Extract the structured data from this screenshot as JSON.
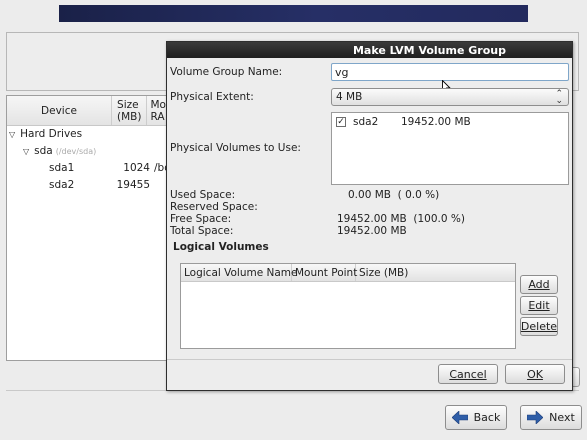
{
  "device_table": {
    "headers": {
      "device": "Device",
      "size_line1": "Size",
      "size_line2": "(MB)",
      "mount_line1": "Mo",
      "mount_line2": "RA"
    },
    "hard_drives_label": "Hard Drives",
    "disk": {
      "name": "sda",
      "path": "(/dev/sda)"
    },
    "partitions": [
      {
        "name": "sda1",
        "size": "1024",
        "mount": "/bo"
      },
      {
        "name": "sda2",
        "size": "19455",
        "mount": ""
      }
    ]
  },
  "dialog": {
    "title": "Make LVM Volume Group",
    "volume_group_name_label": "Volume Group Name:",
    "volume_group_name_value": "vg",
    "physical_extent_label": "Physical Extent:",
    "physical_extent_value": "4 MB",
    "physical_volumes_label": "Physical Volumes to Use:",
    "physical_volumes": [
      {
        "name": "sda2",
        "size": "19452.00 MB",
        "checked": true
      }
    ],
    "used_space_label": "Used Space:",
    "used_space_value": "0.00 MB  ( 0.0 %)",
    "reserved_space_label": "Reserved Space:",
    "reserved_space_value": "",
    "free_space_label": "Free Space:",
    "free_space_value": "19452.00 MB  (100.0 %)",
    "total_space_label": "Total Space:",
    "total_space_value": "19452.00 MB",
    "logical_volumes_label": "Logical Volumes",
    "lv_columns": [
      "Logical Volume Name",
      "Mount Point",
      "Size (MB)"
    ],
    "add_label": "Add",
    "edit_label": "Edit",
    "delete_label": "Delete",
    "cancel_label": "Cancel",
    "ok_label": "OK"
  },
  "nav": {
    "back_label": "Back",
    "next_label": "Next"
  },
  "colors": {
    "banner": "#232a5e",
    "title_bar": "#2a2a2a",
    "nav_arrow": "#2f5ea8"
  }
}
